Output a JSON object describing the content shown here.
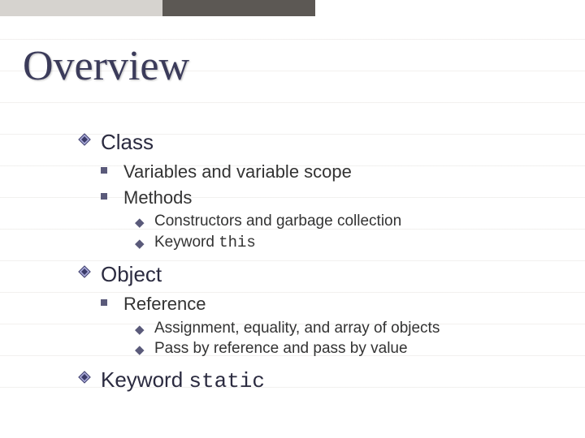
{
  "title": "Overview",
  "items": {
    "class": {
      "label": "Class",
      "sub": {
        "variables": "Variables and variable scope",
        "methods": "Methods",
        "constructors": "Constructors and garbage collection",
        "keyword_this_prefix": "Keyword ",
        "keyword_this_code": "this"
      }
    },
    "object": {
      "label": "Object",
      "sub": {
        "reference": "Reference",
        "assignment": "Assignment, equality, and array of objects",
        "passby": "Pass by reference and pass by value"
      }
    },
    "keyword_static": {
      "prefix": "Keyword ",
      "code": "static"
    }
  }
}
